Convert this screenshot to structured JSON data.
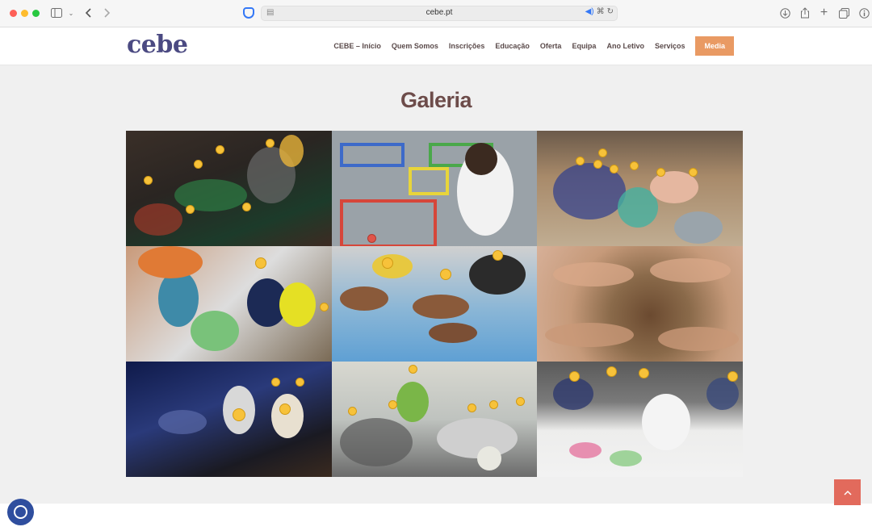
{
  "browser": {
    "url": "cebe.pt",
    "icons": [
      "sidebar-icon",
      "chevron-down-icon",
      "back-icon",
      "forward-icon",
      "shield-icon",
      "reader-icon",
      "audio-icon",
      "translate-icon",
      "reload-icon",
      "download-icon",
      "share-icon",
      "new-tab-icon",
      "tabs-overview-icon",
      "info-icon"
    ]
  },
  "site": {
    "logo": "cebe",
    "nav": [
      {
        "label": "CEBE – Início"
      },
      {
        "label": "Quem Somos"
      },
      {
        "label": "Inscrições"
      },
      {
        "label": "Educação"
      },
      {
        "label": "Oferta"
      },
      {
        "label": "Equipa"
      },
      {
        "label": "Ano Letivo"
      },
      {
        "label": "Serviços"
      },
      {
        "label": "Media"
      }
    ],
    "colors": {
      "logo": "#4b4a82",
      "nav_text": "#5a4a4a",
      "media_button": "#e99a63",
      "title": "#6d4c4a",
      "back_to_top": "#e26a5c",
      "cookie_button": "#2f4e9e"
    }
  },
  "main": {
    "title": "Galeria"
  },
  "controls": {
    "back_to_top_icon": "chevron-up-icon",
    "cookie_icon": "cookie-icon"
  }
}
